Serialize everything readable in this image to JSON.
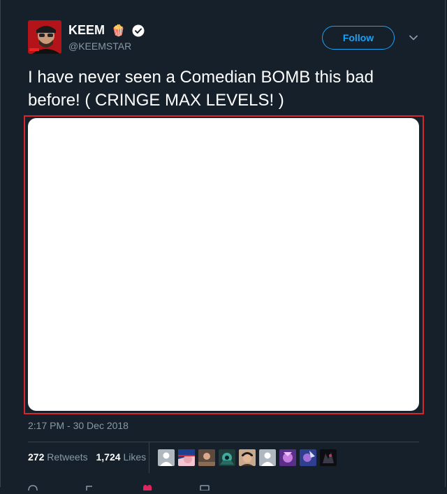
{
  "tweet": {
    "display_name": "KEEM",
    "name_emoji": "🍿",
    "verified": true,
    "handle": "@KEEMSTAR",
    "follow_label": "Follow",
    "text": "I have never seen a Comedian BOMB this bad before! ( CRINGE MAX LEVELS! )",
    "timestamp": "2:17 PM - 30 Dec 2018",
    "retweets": "272",
    "retweets_label": "Retweets",
    "likes": "1,724",
    "likes_label": "Likes"
  },
  "colors": {
    "background": "#15202b",
    "accent": "#1da1f2",
    "muted": "#8899a6",
    "highlight_outline": "#d7262e"
  },
  "likers": [
    {
      "icon": "default-avatar"
    },
    {
      "icon": "avatar-pink"
    },
    {
      "icon": "avatar-photo"
    },
    {
      "icon": "avatar-game"
    },
    {
      "icon": "avatar-face"
    },
    {
      "icon": "default-avatar"
    },
    {
      "icon": "avatar-purple"
    },
    {
      "icon": "avatar-purple-blue"
    },
    {
      "icon": "avatar-dark"
    }
  ]
}
